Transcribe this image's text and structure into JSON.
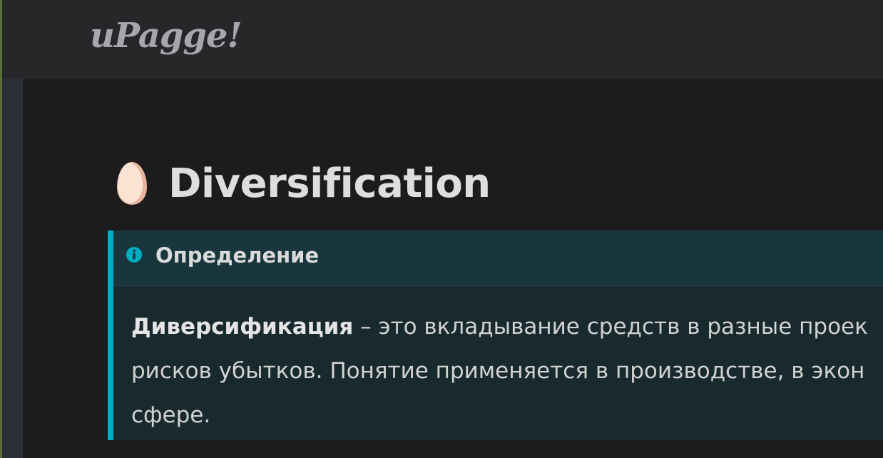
{
  "header": {
    "logo": "uPagge!"
  },
  "page": {
    "title": "Diversification"
  },
  "admonition": {
    "type": "info",
    "title": "Определение",
    "term": "Диверсификация",
    "lines": [
      " – это вкладывание средств в разные проек",
      "рисков убытков. Понятие применяется в производстве, в экон",
      "сфере."
    ]
  },
  "icons": {
    "title_icon": "egg-icon",
    "admonition_icon": "info-circle-icon"
  },
  "colors": {
    "topbar": "#262729",
    "background": "#1c1c1d",
    "admonition_accent": "#00aec4",
    "admonition_header": "#18363c",
    "admonition_body": "#192a2e"
  }
}
